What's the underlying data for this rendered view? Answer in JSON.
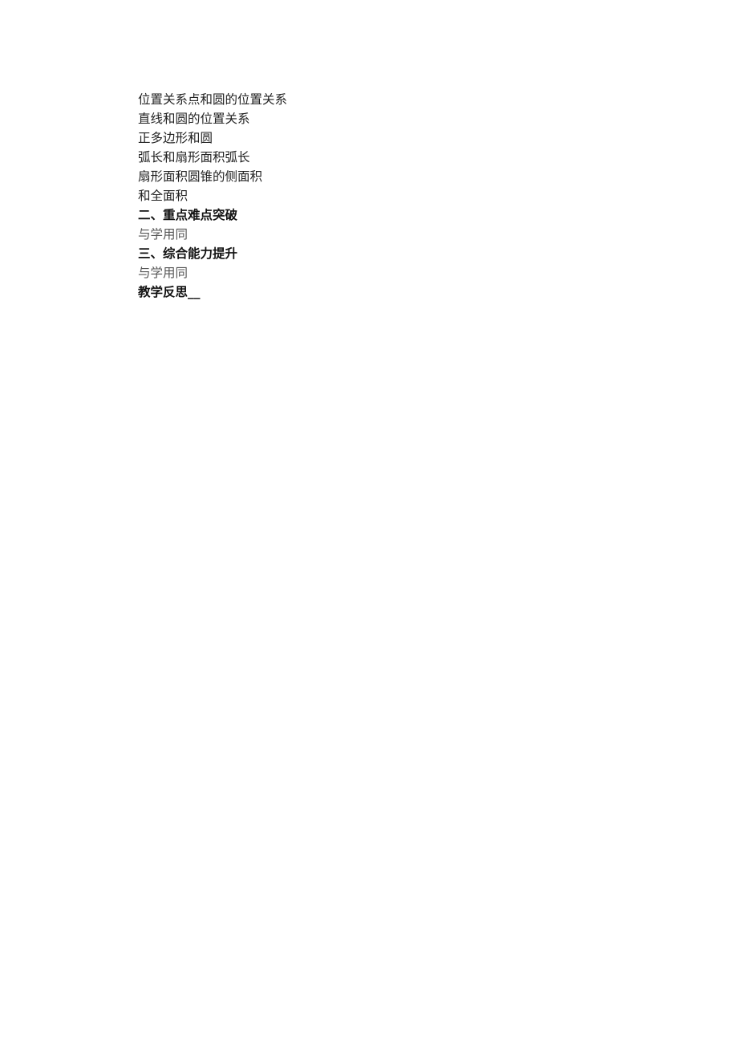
{
  "document": {
    "lines": [
      {
        "text": "位置关系点和圆的位置关系",
        "style": "serif"
      },
      {
        "text": "直线和圆的位置关系",
        "style": "serif"
      },
      {
        "text": "正多边形和圆",
        "style": "serif"
      },
      {
        "text": "弧长和扇形面积弧长",
        "style": "serif"
      },
      {
        "text": "扇形面积圆锥的侧面积",
        "style": "serif"
      },
      {
        "text": "和全面积",
        "style": "serif"
      },
      {
        "text": "二、重点难点突破",
        "style": "heading"
      },
      {
        "text": "与学用同",
        "style": "light"
      },
      {
        "text": "三、综合能力提升",
        "style": "heading"
      },
      {
        "text": "与学用同",
        "style": "light"
      },
      {
        "text": "教学反思__",
        "style": "heading"
      }
    ]
  }
}
